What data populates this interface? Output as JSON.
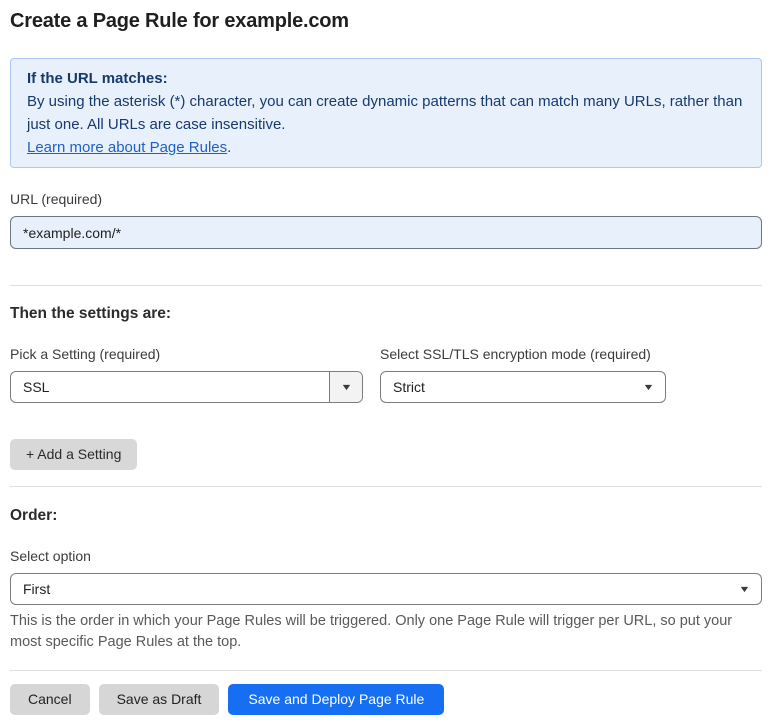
{
  "page": {
    "title": "Create a Page Rule for example.com"
  },
  "info_banner": {
    "heading": "If the URL matches:",
    "body": "By using the asterisk (*) character, you can create dynamic patterns that can match many URLs, rather than just one. All URLs are case insensitive.",
    "link_label": "Learn more about Page Rules",
    "link_suffix": "."
  },
  "url_field": {
    "label": "URL (required)",
    "value": "*example.com/*"
  },
  "settings_section": {
    "heading": "Then the settings are:",
    "setting_picker": {
      "label": "Pick a Setting (required)",
      "value": "SSL"
    },
    "ssl_mode_picker": {
      "label": "Select SSL/TLS encryption mode (required)",
      "value": "Strict"
    },
    "add_setting_label": "+ Add a Setting"
  },
  "order_section": {
    "heading": "Order:",
    "select_label": "Select option",
    "value": "First",
    "help_text": "This is the order in which your Page Rules will be triggered. Only one Page Rule will trigger per URL, so put your most specific Page Rules at the top."
  },
  "footer": {
    "cancel_label": "Cancel",
    "save_draft_label": "Save as Draft",
    "save_deploy_label": "Save and Deploy Page Rule"
  },
  "icons": {
    "caret_down": "▼"
  },
  "colors": {
    "banner_bg": "#e8f1fb",
    "banner_border": "#a9c9ef",
    "banner_text": "#173a6e",
    "link_blue": "#2060c9",
    "input_bg": "#e8f0fb",
    "primary_button": "#166ff2",
    "gray_button": "#d6d6d6"
  }
}
